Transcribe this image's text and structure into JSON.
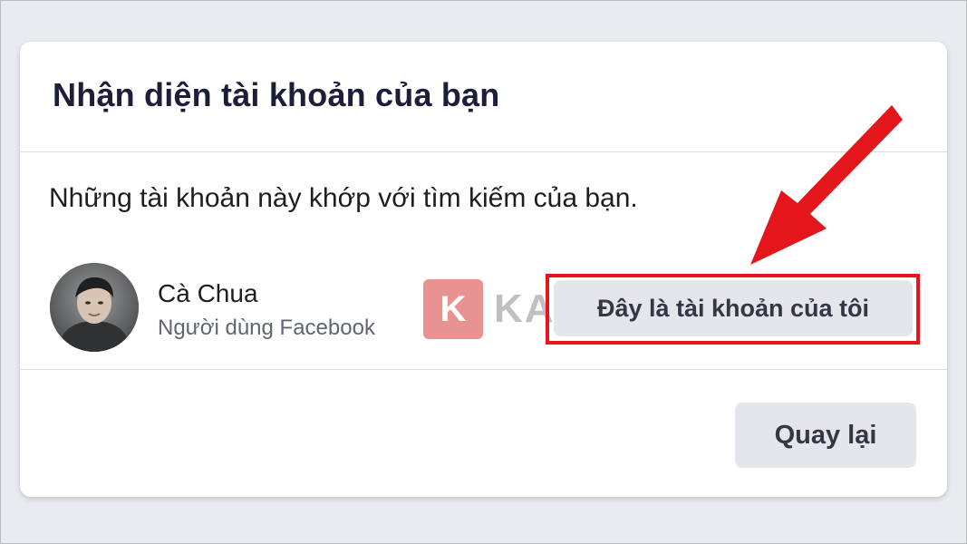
{
  "dialog": {
    "title": "Nhận diện tài khoản của bạn",
    "description": "Những tài khoản này khớp với tìm kiếm của bạn."
  },
  "account": {
    "name": "Cà Chua",
    "subtitle": "Người dùng Facebook",
    "confirm_label": "Đây là tài khoản của tôi"
  },
  "footer": {
    "back_label": "Quay lại"
  },
  "watermark": {
    "letter": "K",
    "text": "KASHI"
  },
  "colors": {
    "annotation_red": "#e4161b",
    "button_gray": "#e4e6eb",
    "title_navy": "#1c1e3a"
  },
  "icons": {
    "avatar": "profile-photo",
    "annotation": "red-arrow-icon"
  }
}
